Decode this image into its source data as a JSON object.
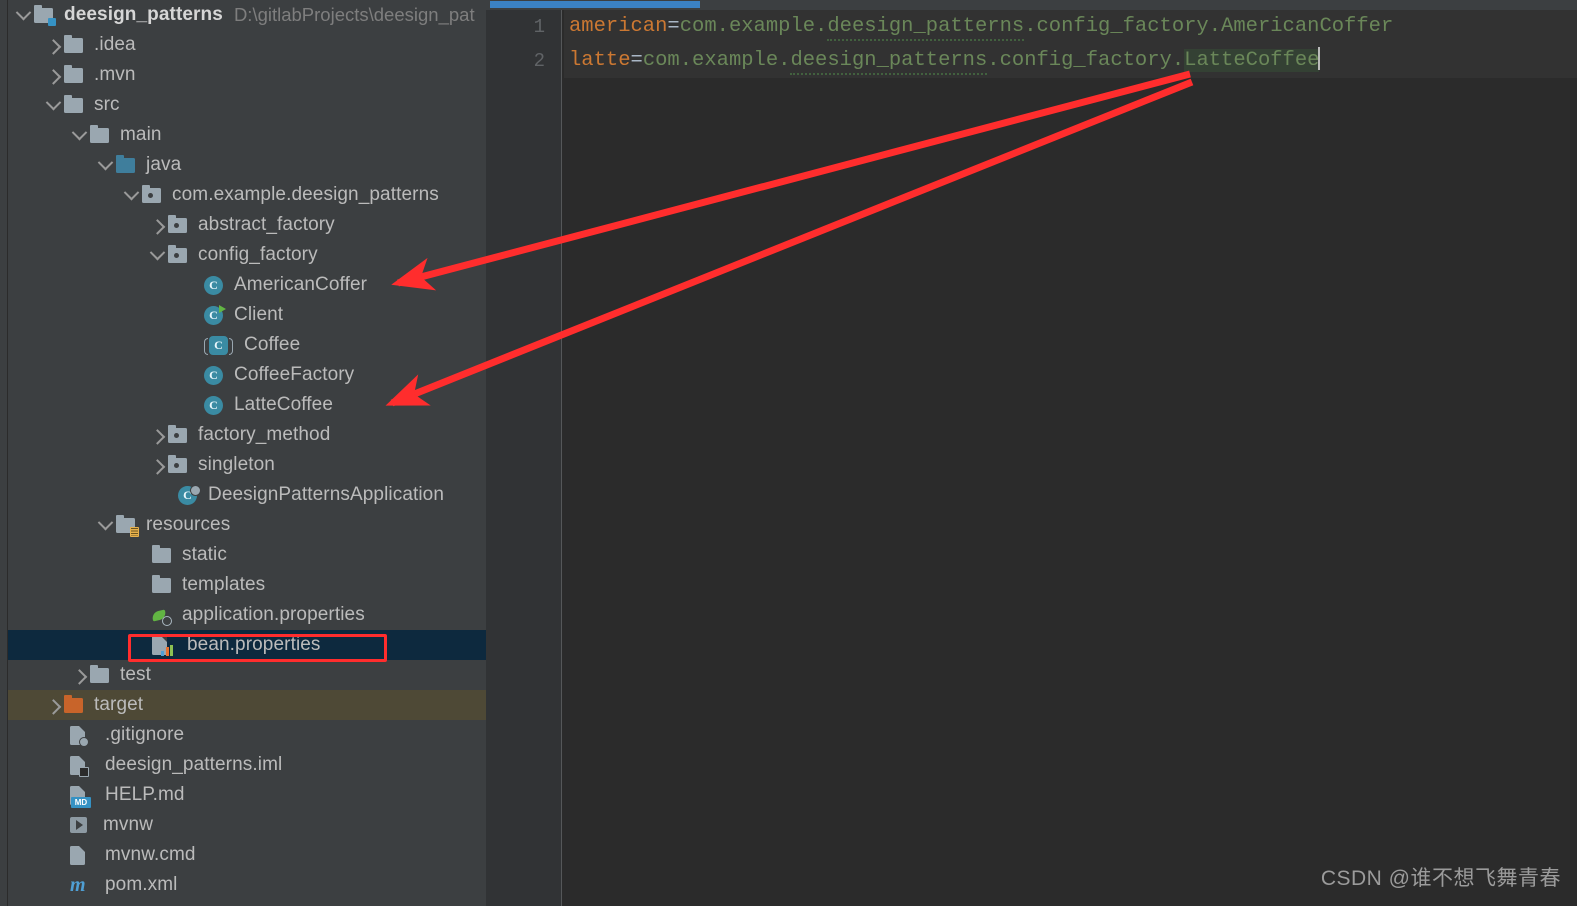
{
  "app": {
    "type": "ide-project-view",
    "colors": {
      "panel_bg": "#3c3f41",
      "editor_bg": "#2b2b2b",
      "gutter_bg": "#313335",
      "selected_row": "#0d293e",
      "target_row": "#4e4936",
      "annotation_red": "#ff2d2d",
      "key_orange": "#cc7832",
      "value_green": "#6a8759",
      "accent_blue": "#3b82c4"
    }
  },
  "project_tree": {
    "root": {
      "label": "deesign_patterns",
      "path": "D:\\gitlabProjects\\deesign_pat"
    },
    "items": [
      {
        "label": "deesign_patterns",
        "path": "D:\\gitlabProjects\\deesign_pat",
        "icon": "folder-module-icon",
        "indent": 0,
        "chevron": "down",
        "state": "normal",
        "bold": true
      },
      {
        "label": ".idea",
        "icon": "folder-icon",
        "indent": 1,
        "chevron": "right",
        "state": "normal"
      },
      {
        "label": ".mvn",
        "icon": "folder-icon",
        "indent": 1,
        "chevron": "right",
        "state": "normal"
      },
      {
        "label": "src",
        "icon": "folder-icon",
        "indent": 1,
        "chevron": "down",
        "state": "normal"
      },
      {
        "label": "main",
        "icon": "folder-icon",
        "indent": 2,
        "chevron": "down",
        "state": "normal"
      },
      {
        "label": "java",
        "icon": "folder-source-icon",
        "indent": 3,
        "chevron": "down",
        "state": "normal"
      },
      {
        "label": "com.example.deesign_patterns",
        "icon": "package-icon",
        "indent": 4,
        "chevron": "down",
        "state": "normal"
      },
      {
        "label": "abstract_factory",
        "icon": "package-icon",
        "indent": 5,
        "chevron": "right",
        "state": "normal"
      },
      {
        "label": "config_factory",
        "icon": "package-icon",
        "indent": 5,
        "chevron": "down",
        "state": "normal"
      },
      {
        "label": "AmericanCoffer",
        "icon": "java-class-icon",
        "indent": 6,
        "chevron": "none",
        "state": "normal"
      },
      {
        "label": "Client",
        "icon": "java-class-runnable-icon",
        "indent": 6,
        "chevron": "none",
        "state": "normal"
      },
      {
        "label": "Coffee",
        "icon": "java-interface-icon",
        "indent": 6,
        "chevron": "none",
        "state": "normal"
      },
      {
        "label": "CoffeeFactory",
        "icon": "java-class-icon",
        "indent": 6,
        "chevron": "none",
        "state": "normal"
      },
      {
        "label": "LatteCoffee",
        "icon": "java-class-icon",
        "indent": 6,
        "chevron": "none",
        "state": "normal"
      },
      {
        "label": "factory_method",
        "icon": "package-icon",
        "indent": 5,
        "chevron": "right",
        "state": "normal"
      },
      {
        "label": "singleton",
        "icon": "package-icon",
        "indent": 5,
        "chevron": "right",
        "state": "normal"
      },
      {
        "label": "DeesignPatternsApplication",
        "icon": "spring-boot-class-icon",
        "indent": 5,
        "chevron": "none",
        "state": "normal"
      },
      {
        "label": "resources",
        "icon": "folder-resources-icon",
        "indent": 3,
        "chevron": "down",
        "state": "normal"
      },
      {
        "label": "static",
        "icon": "folder-icon",
        "indent": 4,
        "chevron": "none",
        "state": "normal"
      },
      {
        "label": "templates",
        "icon": "folder-icon",
        "indent": 4,
        "chevron": "none",
        "state": "normal"
      },
      {
        "label": "application.properties",
        "icon": "spring-properties-icon",
        "indent": 4,
        "chevron": "none",
        "state": "normal"
      },
      {
        "label": "bean.properties",
        "icon": "properties-file-icon",
        "indent": 4,
        "chevron": "none",
        "state": "selected"
      },
      {
        "label": "test",
        "icon": "folder-icon",
        "indent": 2,
        "chevron": "right",
        "state": "normal"
      },
      {
        "label": "target",
        "icon": "folder-excluded-icon",
        "indent": 1,
        "chevron": "right",
        "state": "target"
      },
      {
        "label": ".gitignore",
        "icon": "gitignore-file-icon",
        "indent": 2,
        "chevron": "none",
        "state": "normal"
      },
      {
        "label": "deesign_patterns.iml",
        "icon": "iml-file-icon",
        "indent": 2,
        "chevron": "none",
        "state": "normal"
      },
      {
        "label": "HELP.md",
        "icon": "markdown-file-icon",
        "indent": 2,
        "chevron": "none",
        "state": "normal"
      },
      {
        "label": "mvnw",
        "icon": "shell-script-icon",
        "indent": 2,
        "chevron": "none",
        "state": "normal"
      },
      {
        "label": "mvnw.cmd",
        "icon": "cmd-file-icon",
        "indent": 2,
        "chevron": "none",
        "state": "normal"
      },
      {
        "label": "pom.xml",
        "icon": "maven-xml-icon",
        "indent": 2,
        "chevron": "none",
        "state": "normal"
      }
    ]
  },
  "editor": {
    "line_numbers": [
      "1",
      "2"
    ],
    "lines": [
      {
        "number": "1",
        "key": "american",
        "equals": "=",
        "value_prefix": "com.example.",
        "value_squiggly": "deesign_patterns",
        "value_suffix": ".config_factory.AmericanCoffer",
        "selection": "",
        "caret": false
      },
      {
        "number": "2",
        "key": "latte",
        "equals": "=",
        "value_prefix": "com.example.",
        "value_squiggly": "deesign_patterns",
        "value_suffix": ".config_factory.",
        "selection": "LatteCoffee",
        "caret": true
      }
    ]
  },
  "annotations": {
    "highlight_box_label": "bean.properties",
    "arrows": [
      {
        "from": "editor-line1-AmericanCoffer",
        "to": "tree-item-AmericanCoffer"
      },
      {
        "from": "editor-line2-LatteCoffee",
        "to": "tree-item-LatteCoffee"
      }
    ]
  },
  "watermark": {
    "text": "CSDN @谁不想飞舞青春"
  }
}
